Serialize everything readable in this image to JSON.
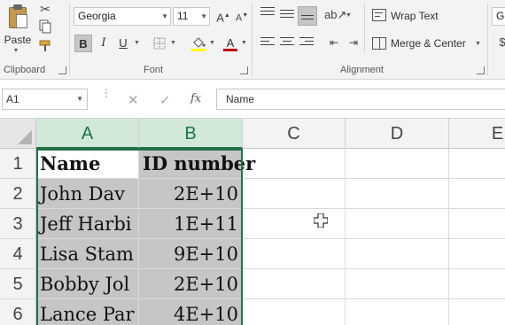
{
  "ribbon": {
    "clipboard": {
      "paste_label": "Paste",
      "group_label": "Clipboard"
    },
    "font": {
      "name": "Georgia",
      "size": "11",
      "grow_label": "A",
      "shrink_label": "A",
      "bold": "B",
      "italic": "I",
      "underline": "U",
      "font_color_letter": "A",
      "group_label": "Font"
    },
    "alignment": {
      "wrap_text": "Wrap Text",
      "merge_center": "Merge & Center",
      "group_label": "Alignment"
    },
    "number": {
      "format_partial": "Ge"
    }
  },
  "formula_bar": {
    "name_box": "A1",
    "cancel_glyph": "✕",
    "enter_glyph": "✓",
    "fx_label": "fx",
    "content": "Name"
  },
  "grid": {
    "columns": [
      "A",
      "B",
      "C",
      "D",
      "E"
    ],
    "rows": [
      "1",
      "2",
      "3",
      "4",
      "5",
      "6"
    ],
    "cells": {
      "A1": "Name",
      "B1": "ID number",
      "A2": "John Dav",
      "B2": "2E+10",
      "A3": "Jeff Harbi",
      "B3": "1E+11",
      "A4": "Lisa Stam",
      "B4": "9E+10",
      "A5": "Bobby Jol",
      "B5": "2E+10",
      "A6": "Lance Par",
      "B6": "4E+10"
    }
  },
  "colors": {
    "accent_green": "#217346",
    "selection_fill": "#c6c6c6",
    "header_selected": "#d2e8d8",
    "font_color_bar": "#c00000",
    "highlight_bar": "#ffff00"
  }
}
